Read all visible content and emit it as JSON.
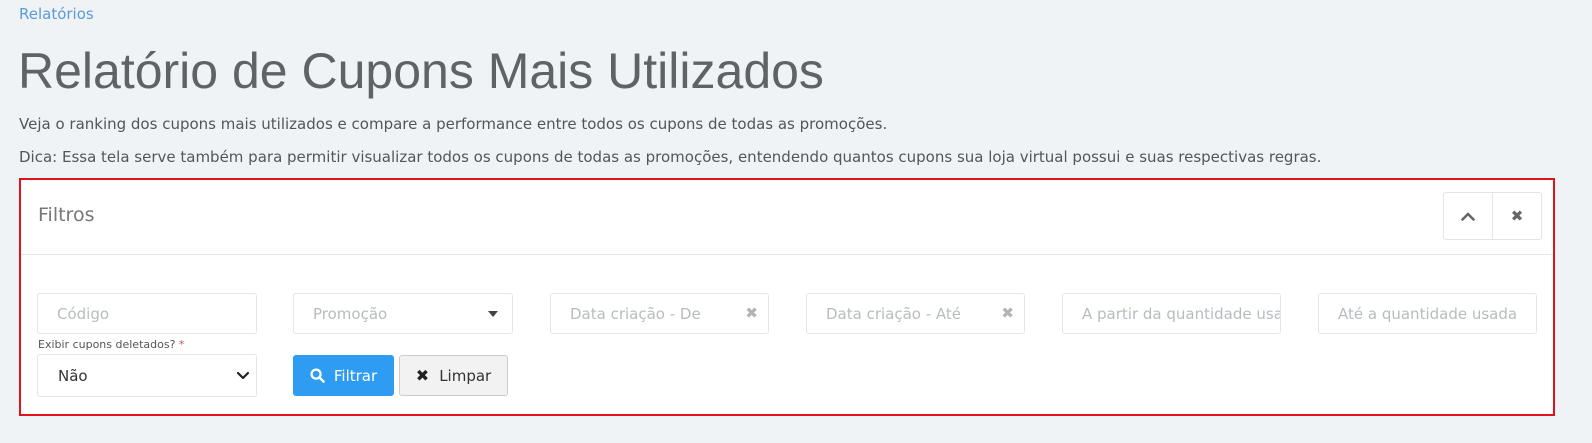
{
  "breadcrumb": "Relatórios",
  "title": "Relatório de Cupons Mais Utilizados",
  "description": "Veja o ranking dos cupons mais utilizados e compare a performance entre todos os cupons de todas as promoções.",
  "tip": "Dica: Essa tela serve também para permitir visualizar todos os cupons de todas as promoções, entendendo quantos cupons sua loja virtual possui e suas respectivas regras.",
  "panel": {
    "title": "Filtros",
    "collapse_icon": "chevron-up-icon",
    "close_icon": "close-icon"
  },
  "filters": {
    "code_placeholder": "Código",
    "promotion_placeholder": "Promoção",
    "date_from_placeholder": "Data criação - De",
    "date_to_placeholder": "Data criação - Até",
    "qty_from_placeholder": "A partir da quantidade usada",
    "qty_to_placeholder": "Até a quantidade usada",
    "deleted_label": "Exibir cupons deletados?",
    "deleted_required_mark": "*",
    "deleted_value": "Não"
  },
  "buttons": {
    "filter_label": "Filtrar",
    "clear_label": "Limpar"
  },
  "colors": {
    "accent": "#2f9cf4",
    "link": "#5b9bd5",
    "highlight_border": "#e0131c"
  }
}
